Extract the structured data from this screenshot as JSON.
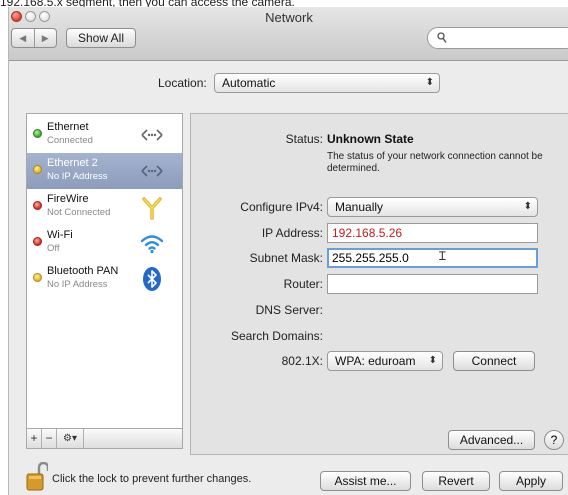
{
  "caption": "192.168.5.x segment, then you can access the camera.",
  "window": {
    "title": "Network"
  },
  "toolbar": {
    "show_all": "Show All",
    "search_placeholder": ""
  },
  "location": {
    "label": "Location:",
    "value": "Automatic"
  },
  "services": [
    {
      "name": "Ethernet",
      "status": "Connected",
      "dot": "green",
      "icon": "ethernet-icon",
      "selected": false
    },
    {
      "name": "Ethernet 2",
      "status": "No IP Address",
      "dot": "yellow",
      "icon": "ethernet-icon",
      "selected": true
    },
    {
      "name": "FireWire",
      "status": "Not Connected",
      "dot": "red",
      "icon": "firewire-icon",
      "selected": false
    },
    {
      "name": "Wi-Fi",
      "status": "Off",
      "dot": "red",
      "icon": "wifi-icon",
      "selected": false
    },
    {
      "name": "Bluetooth PAN",
      "status": "No IP Address",
      "dot": "yellow",
      "icon": "bluetooth-icon",
      "selected": false
    }
  ],
  "sidebar_actions": {
    "add": "+",
    "remove": "−",
    "gear": "⚙▾"
  },
  "detail": {
    "status_label": "Status:",
    "status_value": "Unknown State",
    "status_note": "The status of your network connection cannot be determined.",
    "ipv4_label": "Configure IPv4:",
    "ipv4_value": "Manually",
    "ip_label": "IP Address:",
    "ip_value": "192.168.5.26",
    "subnet_label": "Subnet Mask:",
    "subnet_value": "255.255.255.0",
    "router_label": "Router:",
    "router_value": "",
    "dns_label": "DNS Server:",
    "search_domains_label": "Search Domains:",
    "x8021_label": "802.1X:",
    "x8021_value": "WPA: eduroam",
    "connect": "Connect",
    "advanced": "Advanced...",
    "help": "?"
  },
  "footer": {
    "lock_text": "Click the lock to prevent further changes.",
    "assist": "Assist me...",
    "revert": "Revert",
    "apply": "Apply"
  },
  "colors": {
    "selection": "#96a6c6",
    "ip_text": "#c21b1b",
    "focus_ring": "#6a9ed8"
  }
}
